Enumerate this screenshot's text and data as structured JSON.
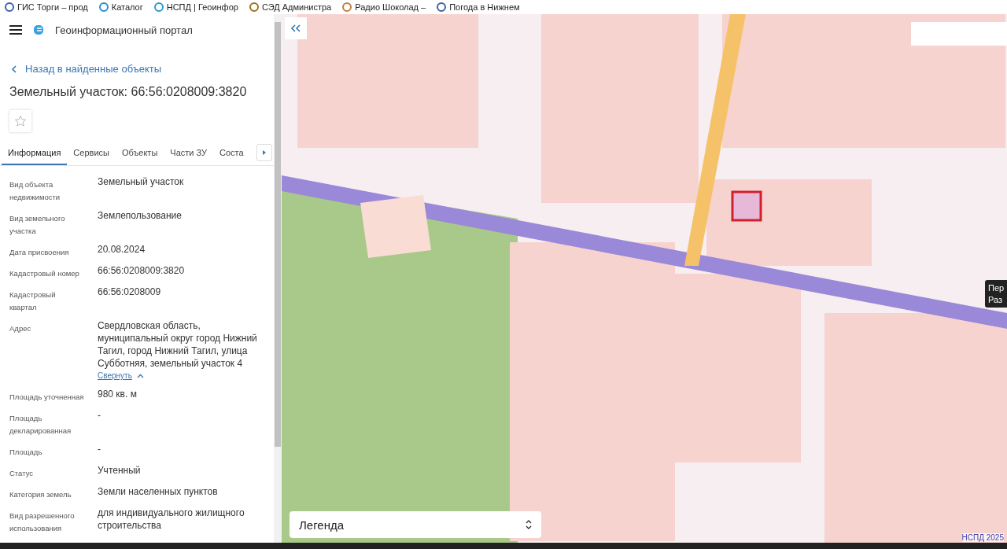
{
  "bookmarks": [
    "ГИС Торги – прод",
    "Каталог",
    "НСПД | Геоинфор",
    "СЭД Администра",
    "Радио Шоколад –",
    "Погода в Нижнем"
  ],
  "header": {
    "title": "Геоинформационный портал"
  },
  "back_link": "Назад в найденные объекты",
  "object_title": "Земельный участок: 66:56:0208009:3820",
  "favorite": {
    "selected": false
  },
  "tabs": [
    {
      "label": "Информация",
      "selected": true
    },
    {
      "label": "Сервисы",
      "selected": false
    },
    {
      "label": "Объекты",
      "selected": false
    },
    {
      "label": "Части ЗУ",
      "selected": false
    },
    {
      "label": "Соста",
      "selected": false
    }
  ],
  "fields": [
    {
      "label": "Вид объекта недвижимости",
      "value": "Земельный участок"
    },
    {
      "label": "Вид земельного участка",
      "value": "Землепользование"
    },
    {
      "label": "Дата присвоения",
      "value": "20.08.2024"
    },
    {
      "label": "Кадастровый номер",
      "value": "66:56:0208009:3820"
    },
    {
      "label": "Кадастровый квартал",
      "value": "66:56:0208009"
    },
    {
      "label": "Адрес",
      "value": "Свердловская область, муниципальный округ город Нижний Тагил, город Нижний Тагил, улица Субботняя, земельный участок 4",
      "toggle": "Свернуть"
    },
    {
      "label": "Площадь уточненная",
      "value": "980 кв. м"
    },
    {
      "label": "Площадь декларированная",
      "value": "-"
    },
    {
      "label": "Площадь",
      "value": "-"
    },
    {
      "label": "Статус",
      "value": "Учтенный"
    },
    {
      "label": "Категория земель",
      "value": "Земли населенных пунктов"
    },
    {
      "label": "Вид разрешенного использования",
      "value": "для индивидуального жилищного строительства"
    }
  ],
  "map": {
    "kind": "picture",
    "tooltip": [
      "Пер",
      "Раз"
    ],
    "legend": "Легенда",
    "attribution": "НСПД 2025"
  }
}
